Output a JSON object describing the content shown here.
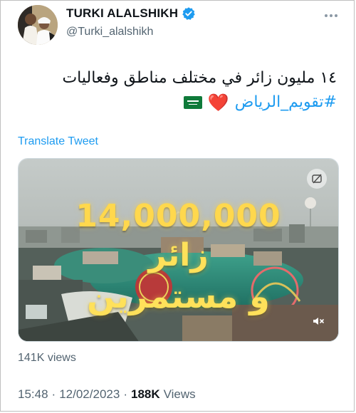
{
  "user": {
    "name": "TURKI ALALSHIKH",
    "handle": "@Turki_alalshikh"
  },
  "tweet": {
    "line1": "١٤ مليون زائر في مختلف مناطق وفعاليات",
    "hashtag": "#تقويم_الرياض",
    "heart": "❤️"
  },
  "translate_label": "Translate Tweet",
  "media": {
    "number_text": "14,000,000",
    "arabic_line1": "زائر",
    "arabic_line2": "و مستمرين",
    "top_icon": "no-caption-icon",
    "bottom_icon": "muted-speaker-icon"
  },
  "media_views": "141K views",
  "footer": {
    "time": "15:48",
    "separator": "·",
    "date": "12/02/2023",
    "views_count": "188K",
    "views_label": "Views"
  },
  "colors": {
    "link": "#1d9bf0",
    "muted": "#536471",
    "verified": "#1d9bf0",
    "overlay_text": "#ffd84d"
  }
}
